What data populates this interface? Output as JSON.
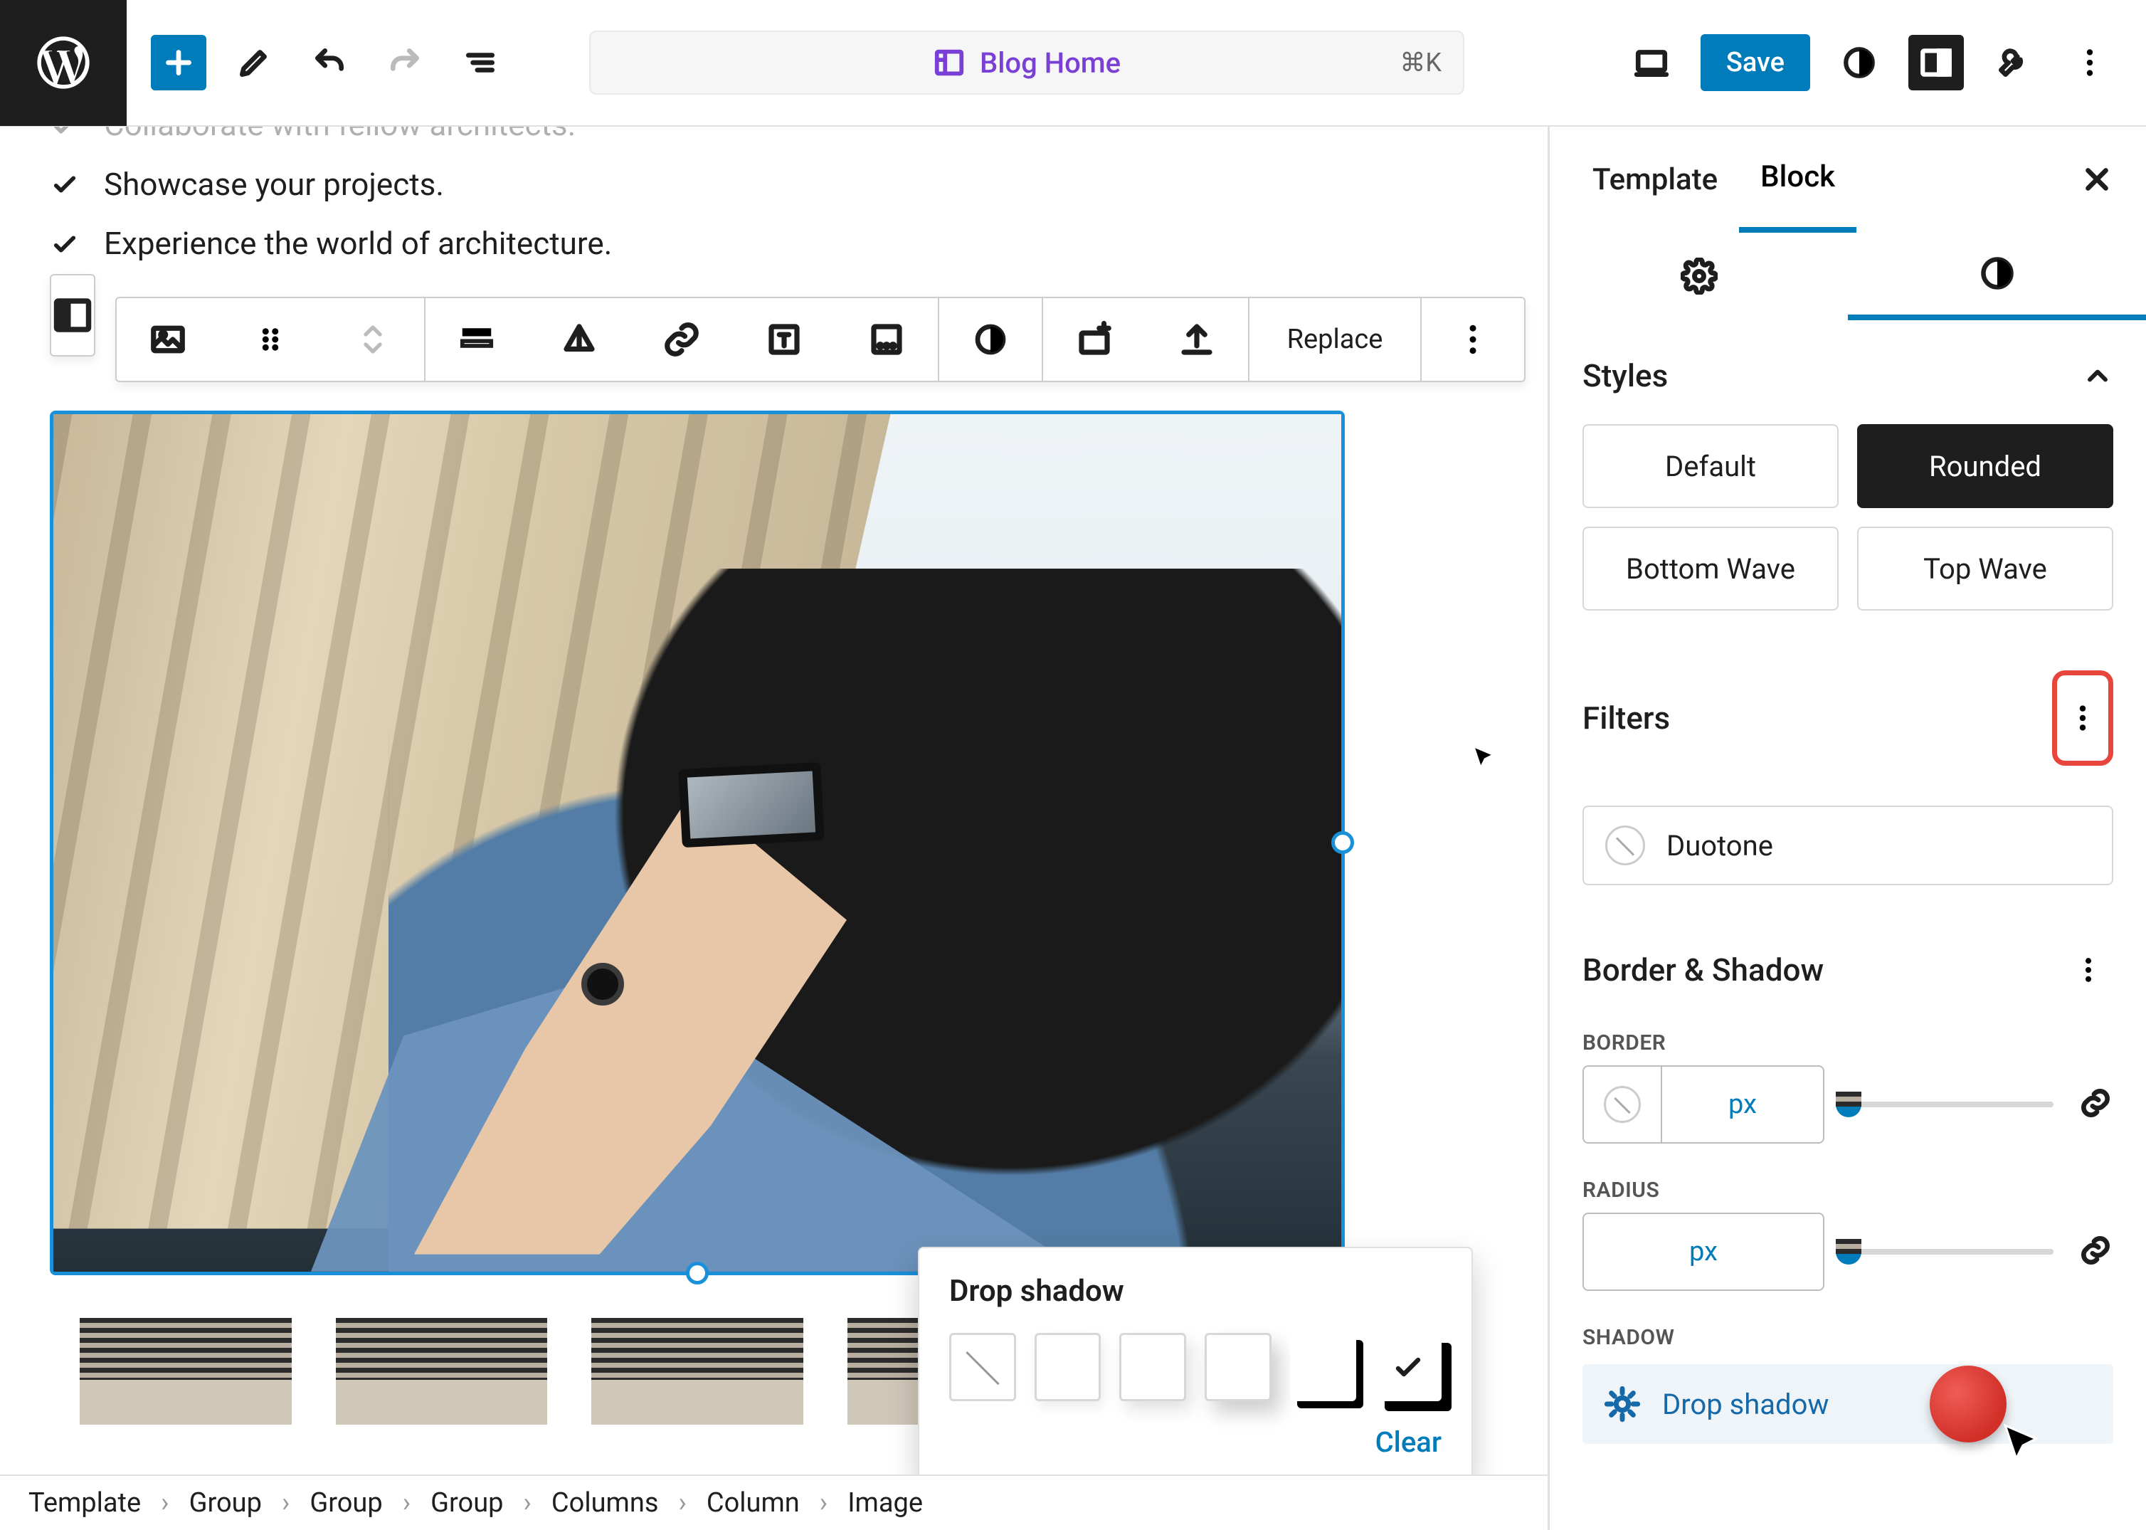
{
  "topbar": {
    "title": "Blog Home",
    "shortcut": "⌘K",
    "save": "Save"
  },
  "checklist": [
    "Collaborate with fellow architects.",
    "Showcase your projects.",
    "Experience the world of architecture."
  ],
  "block_toolbar": {
    "replace": "Replace"
  },
  "popover": {
    "title": "Drop shadow",
    "clear": "Clear",
    "selected_index": 5
  },
  "breadcrumb": [
    "Template",
    "Group",
    "Group",
    "Group",
    "Columns",
    "Column",
    "Image"
  ],
  "sidebar": {
    "tabs": {
      "template": "Template",
      "block": "Block"
    },
    "sections": {
      "styles": {
        "title": "Styles",
        "options": [
          "Default",
          "Rounded",
          "Bottom Wave",
          "Top Wave"
        ],
        "active": "Rounded"
      },
      "filters": {
        "title": "Filters",
        "duotone": "Duotone"
      },
      "border_shadow": {
        "title": "Border & Shadow",
        "border_label": "BORDER",
        "border_unit": "px",
        "radius_label": "RADIUS",
        "radius_unit": "px",
        "shadow_label": "SHADOW",
        "shadow_btn": "Drop shadow"
      }
    }
  }
}
